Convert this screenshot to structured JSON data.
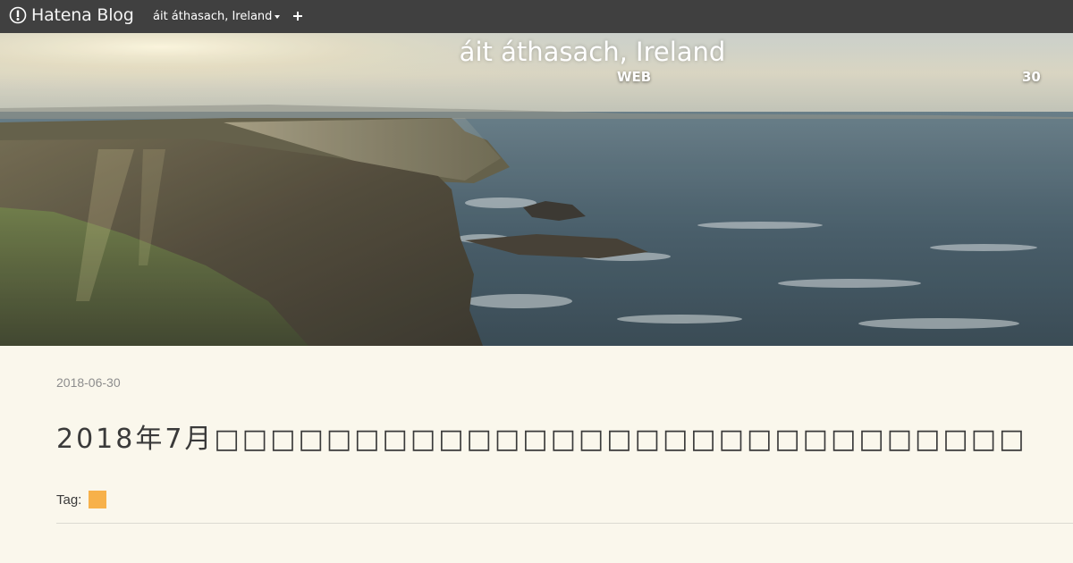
{
  "navbar": {
    "brand_text": "Hatena Blog",
    "brand_icon": "hatena-logo-icon",
    "blog_menu_label": "áit áthasach, Ireland",
    "add_icon": "plus-icon",
    "background": "#404040"
  },
  "header": {
    "blog_title": "áit áthasach, Ireland",
    "description": "WEB",
    "description_number": "30"
  },
  "entry": {
    "date": "2018-06-30",
    "title": "2018年7月□□□□□□□□□□□□□□□□□□□□□□□□□□□□□",
    "tag_label": "Tag:",
    "tag_color": "#f7b14a"
  },
  "colors": {
    "page_background": "#faf7ec",
    "text": "#3a3a3a",
    "date_text": "#8d8d8d"
  }
}
